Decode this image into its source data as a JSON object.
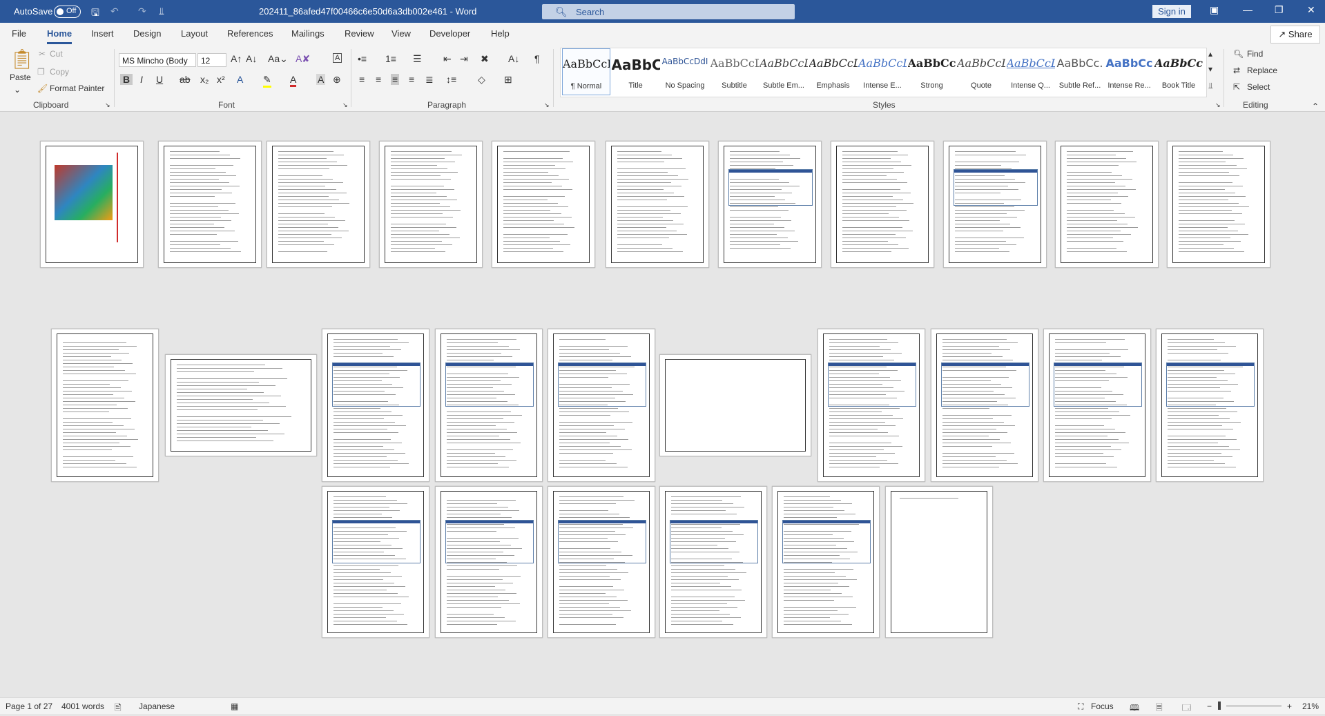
{
  "titlebar": {
    "autosave_label": "AutoSave",
    "autosave_state": "Off",
    "doc_title": "202411_86afed47f00466c6e50d6a3db002e461  -  Word",
    "search_placeholder": "Search",
    "signin_label": "Sign in"
  },
  "tabs": [
    "File",
    "Home",
    "Insert",
    "Design",
    "Layout",
    "References",
    "Mailings",
    "Review",
    "View",
    "Developer",
    "Help"
  ],
  "active_tab": "Home",
  "share_label": "Share",
  "clipboard": {
    "paste": "Paste",
    "cut": "Cut",
    "copy": "Copy",
    "format_painter": "Format Painter",
    "label": "Clipboard"
  },
  "font": {
    "name": "MS Mincho (Body",
    "size": "12",
    "label": "Font"
  },
  "paragraph": {
    "label": "Paragraph"
  },
  "styles": {
    "label": "Styles",
    "items": [
      {
        "sample": "AaBbCcI",
        "name": "¶ Normal"
      },
      {
        "sample": "AaBbC",
        "name": "Title"
      },
      {
        "sample": "AaBbCcDdI",
        "name": "No Spacing"
      },
      {
        "sample": "AaBbCcD",
        "name": "Subtitle"
      },
      {
        "sample": "AaBbCcL",
        "name": "Subtle Em..."
      },
      {
        "sample": "AaBbCcL",
        "name": "Emphasis"
      },
      {
        "sample": "AaBbCcL",
        "name": "Intense E..."
      },
      {
        "sample": "AaBbCcl",
        "name": "Strong"
      },
      {
        "sample": "AaBbCcL",
        "name": "Quote"
      },
      {
        "sample": "AaBbCcL",
        "name": "Intense Q..."
      },
      {
        "sample": "AaBbCc.",
        "name": "Subtle Ref..."
      },
      {
        "sample": "AaBbCc",
        "name": "Intense Re..."
      },
      {
        "sample": "AaBbCc",
        "name": "Book Title"
      }
    ]
  },
  "editing": {
    "find": "Find",
    "replace": "Replace",
    "select": "Select",
    "label": "Editing"
  },
  "status": {
    "page": "Page 1 of 27",
    "words": "4001 words",
    "language": "Japanese",
    "focus": "Focus",
    "zoom": "21%"
  },
  "colors": {
    "brand": "#2b579a",
    "accent_red": "#d02b2b",
    "highlight": "#ffff00"
  },
  "page_count": 27
}
